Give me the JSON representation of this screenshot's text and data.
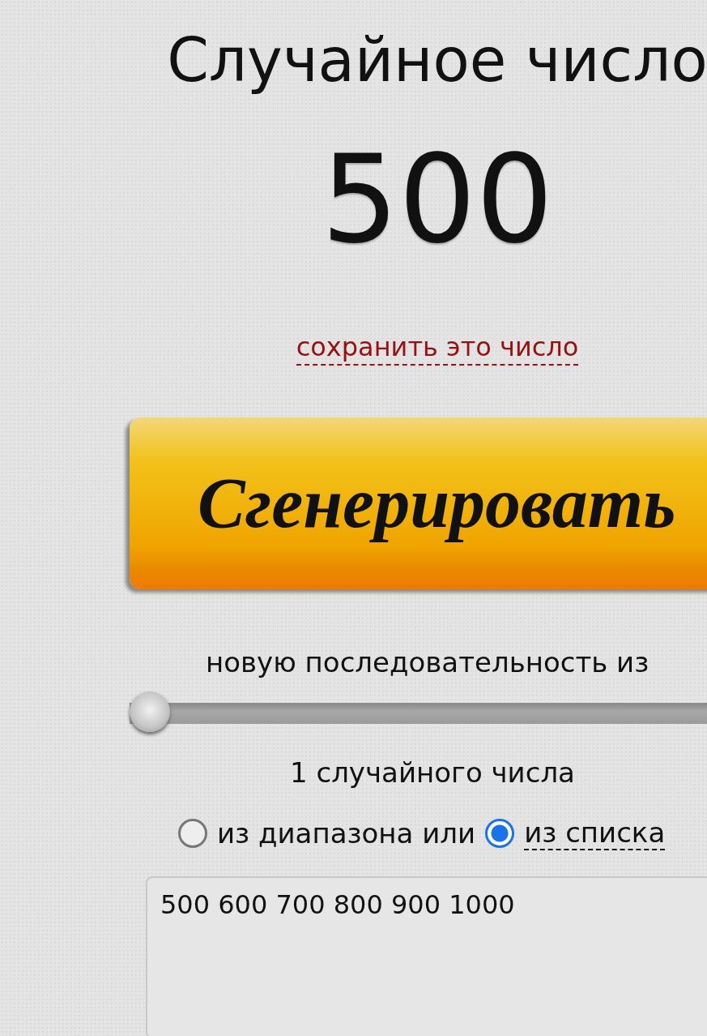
{
  "title": "Случайное число",
  "result": "500",
  "save_link": "сохранить это число",
  "generate_button": "Сгенерировать",
  "sequence_label": "новую последовательность из",
  "count_slider": {
    "level": 0
  },
  "count_label": "1 случайного числа",
  "source_options": [
    {
      "label": "из диапазона или",
      "selected": false,
      "kind": "plain"
    },
    {
      "label": "из списка",
      "selected": true,
      "kind": "link"
    }
  ],
  "list_field": {
    "value": "500 600 700 800 900 1000"
  }
}
